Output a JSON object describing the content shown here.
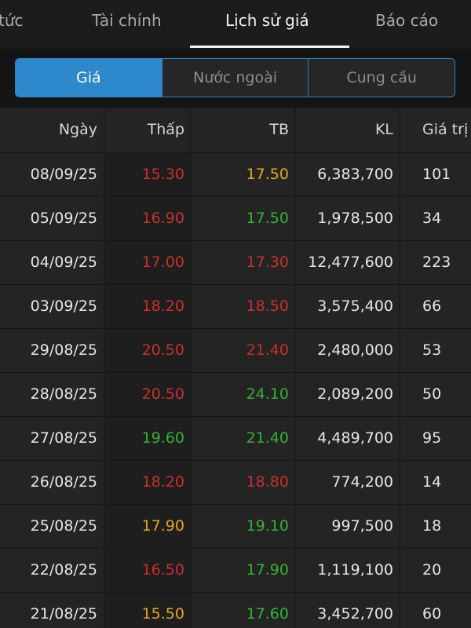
{
  "top_tabs": [
    {
      "label": "tức"
    },
    {
      "label": "Tài chính"
    },
    {
      "label": "Lịch sử giá"
    },
    {
      "label": "Báo cáo"
    }
  ],
  "segments": [
    {
      "label": "Giá"
    },
    {
      "label": "Nước ngoài"
    },
    {
      "label": "Cung cầu"
    }
  ],
  "table": {
    "headers": {
      "date": "Ngày",
      "low": "Thấp",
      "avg": "TB",
      "volume": "KL",
      "value": "Giá trị ("
    },
    "rows": [
      {
        "date": "08/09/25",
        "low": "15.30",
        "low_color": "red",
        "avg": "17.50",
        "avg_color": "yellow",
        "volume": "6,383,700",
        "value": "101"
      },
      {
        "date": "05/09/25",
        "low": "16.90",
        "low_color": "red",
        "avg": "17.50",
        "avg_color": "green",
        "volume": "1,978,500",
        "value": "34"
      },
      {
        "date": "04/09/25",
        "low": "17.00",
        "low_color": "red",
        "avg": "17.30",
        "avg_color": "red",
        "volume": "12,477,600",
        "value": "223"
      },
      {
        "date": "03/09/25",
        "low": "18.20",
        "low_color": "red",
        "avg": "18.50",
        "avg_color": "red",
        "volume": "3,575,400",
        "value": "66"
      },
      {
        "date": "29/08/25",
        "low": "20.50",
        "low_color": "red",
        "avg": "21.40",
        "avg_color": "red",
        "volume": "2,480,000",
        "value": "53"
      },
      {
        "date": "28/08/25",
        "low": "20.50",
        "low_color": "red",
        "avg": "24.10",
        "avg_color": "green",
        "volume": "2,089,200",
        "value": "50"
      },
      {
        "date": "27/08/25",
        "low": "19.60",
        "low_color": "green",
        "avg": "21.40",
        "avg_color": "green",
        "volume": "4,489,700",
        "value": "95"
      },
      {
        "date": "26/08/25",
        "low": "18.20",
        "low_color": "red",
        "avg": "18.80",
        "avg_color": "red",
        "volume": "774,200",
        "value": "14"
      },
      {
        "date": "25/08/25",
        "low": "17.90",
        "low_color": "yellow",
        "avg": "19.10",
        "avg_color": "green",
        "volume": "997,500",
        "value": "18"
      },
      {
        "date": "22/08/25",
        "low": "16.50",
        "low_color": "red",
        "avg": "17.90",
        "avg_color": "green",
        "volume": "1,119,100",
        "value": "20"
      },
      {
        "date": "21/08/25",
        "low": "15.50",
        "low_color": "yellow",
        "avg": "17.60",
        "avg_color": "green",
        "volume": "3,452,700",
        "value": "60"
      }
    ]
  },
  "colors": {
    "red": "#c9302c",
    "green": "#34b233",
    "yellow": "#e3a818",
    "accent": "#2d88cc"
  }
}
